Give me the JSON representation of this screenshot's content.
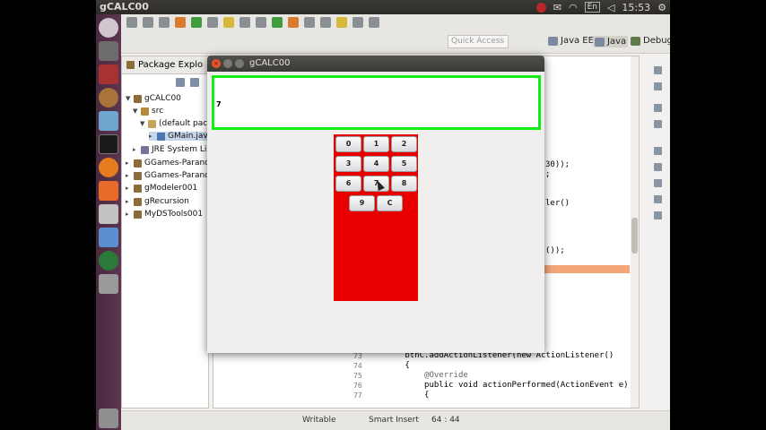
{
  "top_panel": {
    "app_title": "gCALC00",
    "keyboard_layout": "En",
    "clock": "15:53"
  },
  "toolbar": {
    "quick_access_placeholder": "Quick Access",
    "perspectives": [
      "Java EE",
      "Java",
      "Debug"
    ]
  },
  "package_explorer": {
    "tab_label": "Package Explo",
    "tree": [
      {
        "label": "gCALC00",
        "icon": "project-icon"
      },
      {
        "label": "src",
        "icon": "source-folder-icon"
      },
      {
        "label": "(default packa",
        "icon": "package-icon"
      },
      {
        "label": "GMain.java",
        "icon": "java-file-icon"
      },
      {
        "label": "JRE System Libr",
        "icon": "library-icon"
      },
      {
        "label": "GGames-Paranoic",
        "icon": "project-icon"
      },
      {
        "label": "GGames-Paranoic",
        "icon": "project-icon"
      },
      {
        "label": "gModeler001",
        "icon": "project-icon"
      },
      {
        "label": "gRecursion",
        "icon": "project-icon"
      },
      {
        "label": "MyDSTools001",
        "icon": "project-icon"
      }
    ]
  },
  "editor": {
    "visible_fragments": [
      "30));",
      ";",
      "ler()",
      "());"
    ],
    "lines": [
      {
        "num": "73",
        "text": "        btnC.addActionListener(new ActionListener()"
      },
      {
        "num": "74",
        "text": "        {"
      },
      {
        "num": "75",
        "text": "            @Override"
      },
      {
        "num": "76",
        "text": "            public void actionPerformed(ActionEvent e)"
      },
      {
        "num": "77",
        "text": "            {"
      }
    ]
  },
  "status_bar": {
    "mode": "Writable",
    "insert": "Smart Insert",
    "position": "64 : 44"
  },
  "calc_window": {
    "title": "gCALC00",
    "display_value": "7",
    "buttons": [
      "0",
      "1",
      "2",
      "3",
      "4",
      "5",
      "6",
      "7",
      "8",
      "9",
      "C"
    ],
    "colors": {
      "display_border": "#12ee12",
      "keypad_bg": "#e80000"
    }
  }
}
